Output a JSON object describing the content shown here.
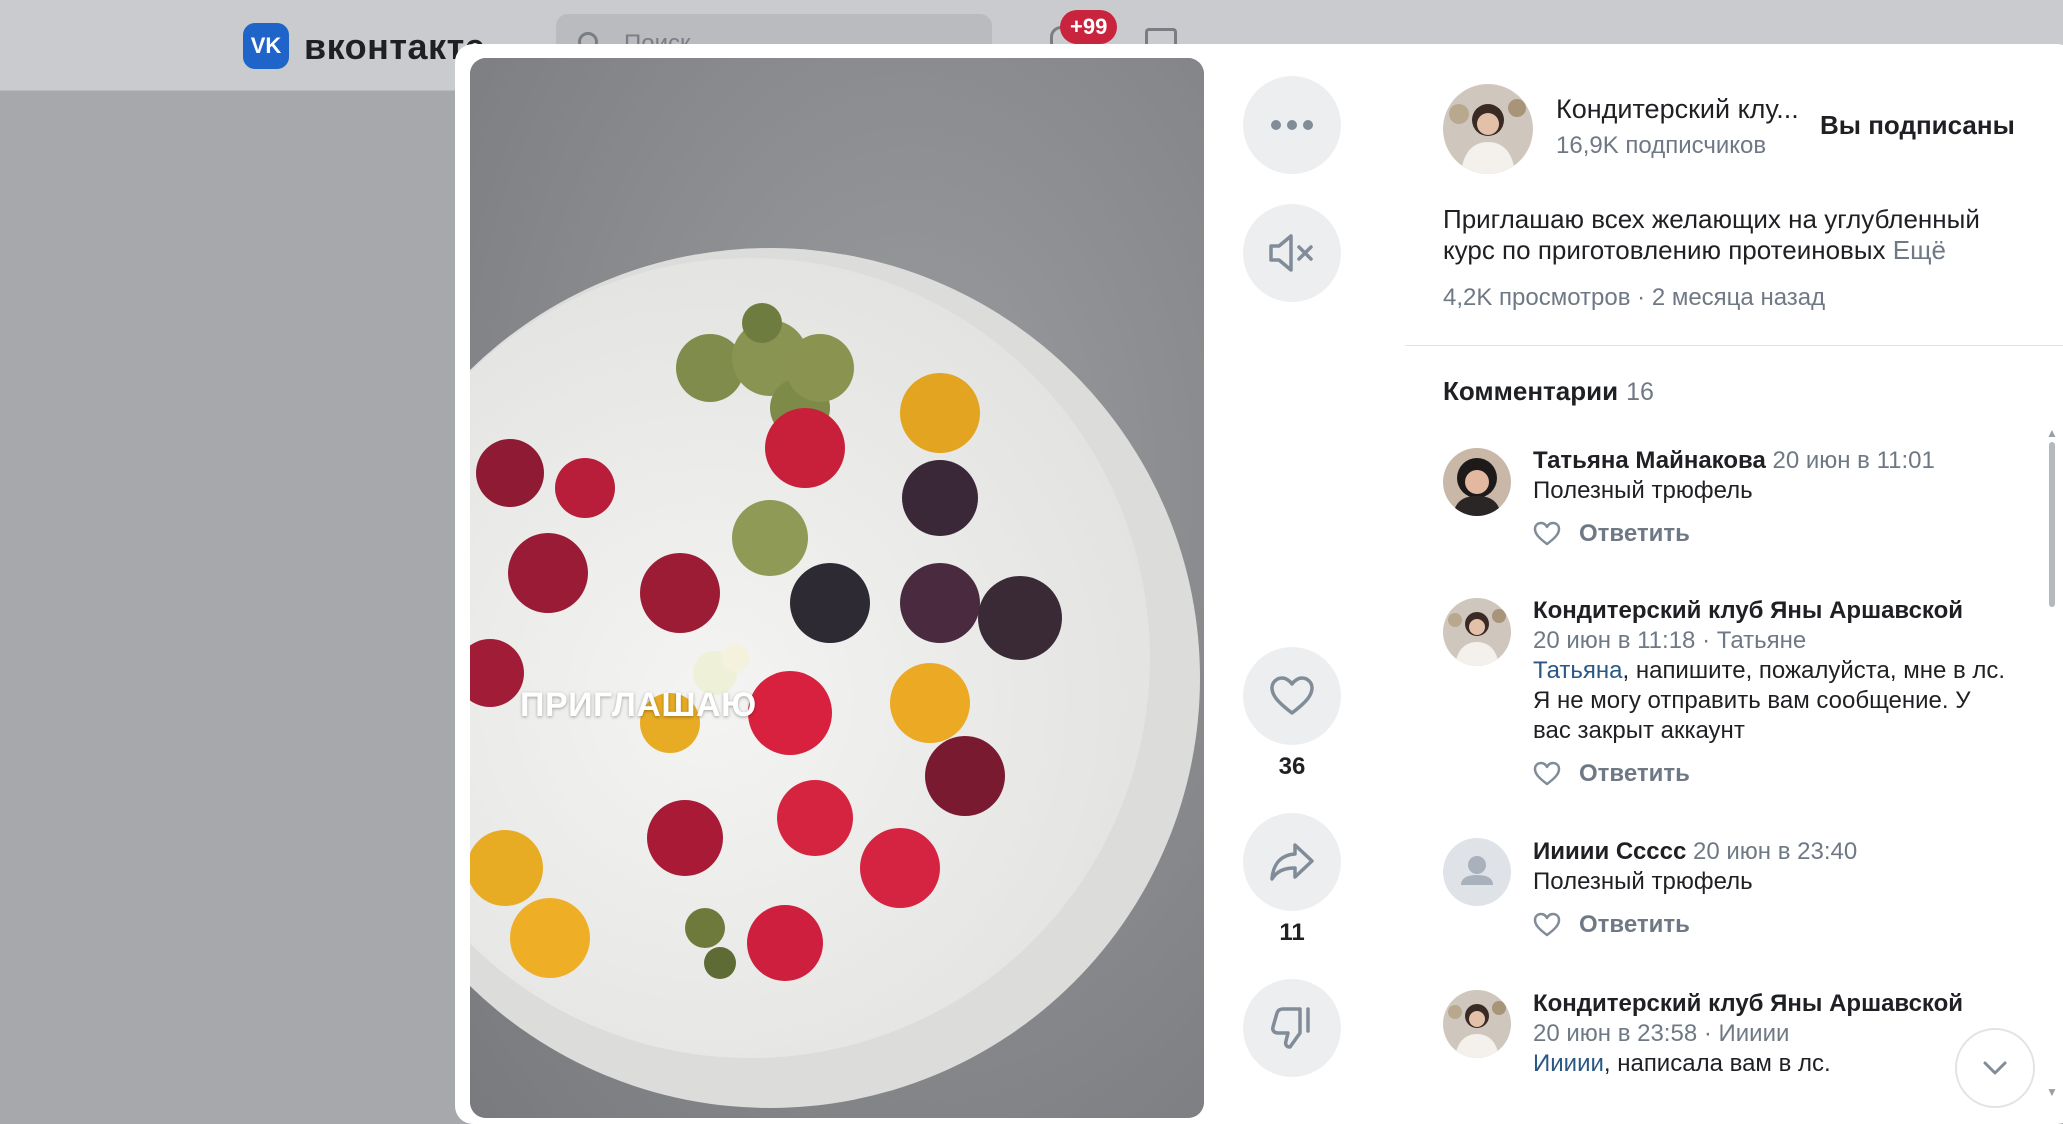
{
  "header": {
    "logo_glyph": "VK",
    "brand": "вконтакте",
    "search_placeholder": "Поиск",
    "notifications_badge": "+99"
  },
  "video": {
    "caption": "ПРИГЛАШАЮ"
  },
  "actions": {
    "more_icon": "more-horizontal-icon",
    "mute_icon": "volume-muted-icon",
    "like_count": "36",
    "share_count": "11",
    "dislike_icon": "thumbs-down-icon"
  },
  "group": {
    "name": "Кондитерский клу...",
    "subscribers": "16,9K подписчиков",
    "subscribe_state": "Вы подписаны"
  },
  "post": {
    "description_line1": "Приглашаю всех желающих на углубленный",
    "description_line2": "курс по приготовлению протеиновых",
    "more_label": "Ещё",
    "meta": "4,2K просмотров · 2 месяца назад"
  },
  "comments": {
    "title": "Комментарии",
    "count": "16",
    "items": [
      {
        "author": "Татьяна Майнакова",
        "date": "20 июн в 11:01",
        "text": "Полезный трюфель",
        "reply_label": "Ответить"
      },
      {
        "author": "Кондитерский клуб Яны Аршавской",
        "date": "20 июн в 11:18",
        "reply_to": "Татьяне",
        "mention": "Татьяна",
        "text_after_mention": ", напишите, пожалуйста, мне в лс.",
        "text_line2": "Я не могу отправить вам сообщение. У",
        "text_line3": "вас закрыт аккаунт",
        "reply_label": "Ответить"
      },
      {
        "author": "Иииии Ссссс",
        "date": "20 июн в 23:40",
        "text": "Полезный трюфель",
        "reply_label": "Ответить"
      },
      {
        "author": "Кондитерский клуб Яны Аршавской",
        "date": "20 июн в 23:58",
        "reply_to": "Иииии",
        "mention": "Иииии",
        "text_after_mention": ", написала вам в лс."
      }
    ]
  },
  "colors": {
    "accent": "#2a5885",
    "brand": "#1f64c9",
    "muted_text": "#6f7985",
    "badge": "#c9243d"
  }
}
